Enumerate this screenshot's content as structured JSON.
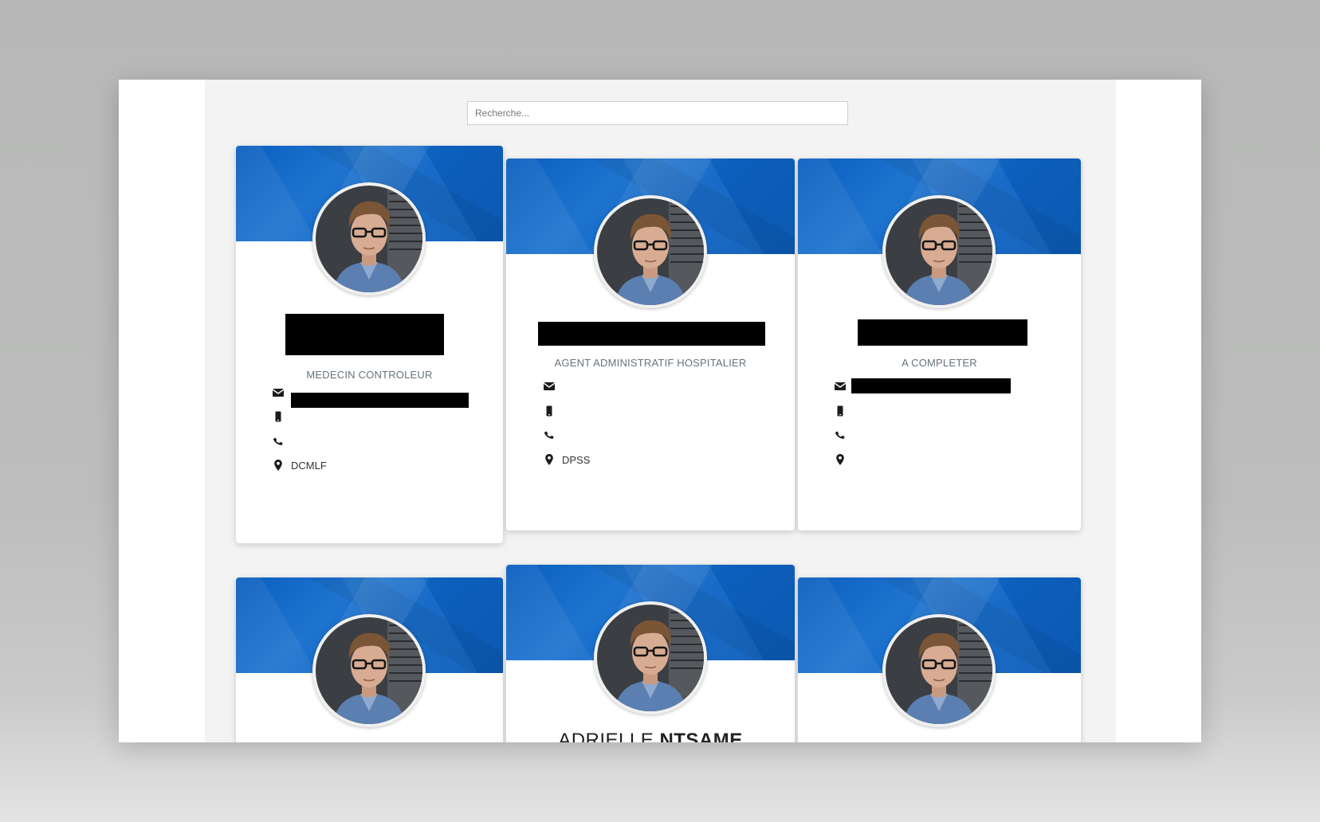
{
  "search": {
    "placeholder": "Recherche..."
  },
  "cards": [
    {
      "role": "MEDECIN CONTROLEUR",
      "email": "",
      "mobile": "",
      "phone": "",
      "location": "DCMLF"
    },
    {
      "role": "AGENT ADMINISTRATIF HOSPITALIER",
      "email": "",
      "mobile": "",
      "phone": "",
      "location": "DPSS"
    },
    {
      "role": "A COMPLETER",
      "email": "",
      "mobile": "",
      "phone": "",
      "location": ""
    },
    {
      "role": ""
    },
    {
      "name_first": "ADRIELLE",
      "name_last": "NTSAME",
      "role": ""
    },
    {
      "role": ""
    }
  ],
  "icons": {
    "email": "envelope-icon",
    "mobile": "mobile-icon",
    "phone": "phone-icon",
    "location": "map-marker-icon"
  },
  "colors": {
    "banner": "#0b63c4",
    "page_bg": "#f3f3f3",
    "role_text": "#65737c"
  }
}
